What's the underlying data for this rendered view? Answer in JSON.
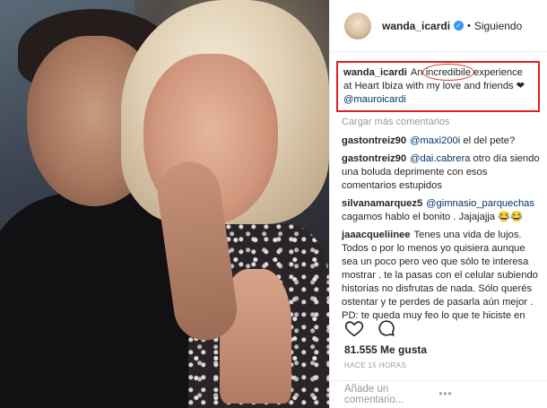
{
  "post": {
    "author": "wanda_icardi",
    "follow_label": "Siguiendo",
    "separator": "•",
    "verified_mark": "✓",
    "caption": {
      "user": "wanda_icardi",
      "text_pre": "An ",
      "text_circled": "incredibile",
      "text_post": " experience at Heart Ibiza with my love and friends ❤",
      "mention": "@mauroicardi"
    },
    "load_more": "Cargar más comentarios",
    "comments": [
      {
        "user": "gastontreiz90",
        "mention": "@maxi200i",
        "text": " el del pete?"
      },
      {
        "user": "gastontreiz90",
        "mention": "@dai.cabrera",
        "text": " otro día siendo una boluda deprimente con esos comentarios estupidos"
      },
      {
        "user": "silvanamarquez5",
        "mention": "@gimnasio_parquechas",
        "text": " cagamos hablo el bonito . Jajajajja 😂😂"
      },
      {
        "user": "jaaacqueliinee",
        "mention": "",
        "text": "Tenes una vida de lujos. Todos o por lo menos yo quisiera aunque sea un poco pero veo que sólo te interesa mostrar . te la pasas con el celular subiendo historias no disfrutas de nada. Sólo querés ostentar y te perdes de pasarla aún mejor . PD: te queda muy feo lo que te hiciste en los pómulos."
      }
    ],
    "likes": "81.555 Me gusta",
    "timestamp": "HACE 15 HORAS",
    "comment_placeholder": "Añade un comentario...",
    "more_options": "•••"
  },
  "icons": {
    "like": "heart-icon",
    "comment": "comment-icon"
  }
}
